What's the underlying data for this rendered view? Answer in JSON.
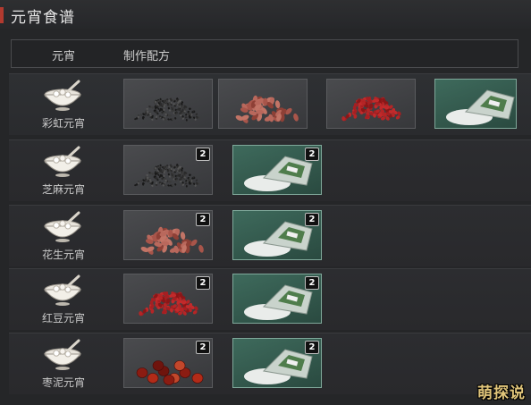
{
  "window": {
    "title": "元宵食谱"
  },
  "header": {
    "col_name": "元宵",
    "col_recipe": "制作配方"
  },
  "rows": [
    {
      "name": "彩虹元宵",
      "ingredients": [
        {
          "item": "black-sesame",
          "count": ""
        },
        {
          "item": "peanuts",
          "count": ""
        },
        {
          "item": "red-beans",
          "count": ""
        },
        {
          "item": "glutinous-rice-flour",
          "count": ""
        }
      ]
    },
    {
      "name": "芝麻元宵",
      "ingredients": [
        {
          "item": "black-sesame",
          "count": "2"
        },
        {
          "item": "glutinous-rice-flour",
          "count": "2"
        }
      ]
    },
    {
      "name": "花生元宵",
      "ingredients": [
        {
          "item": "peanuts",
          "count": "2"
        },
        {
          "item": "glutinous-rice-flour",
          "count": "2"
        }
      ]
    },
    {
      "name": "红豆元宵",
      "ingredients": [
        {
          "item": "red-beans",
          "count": "2"
        },
        {
          "item": "glutinous-rice-flour",
          "count": "2"
        }
      ]
    },
    {
      "name": "枣泥元宵",
      "ingredients": [
        {
          "item": "red-dates",
          "count": "2"
        },
        {
          "item": "glutinous-rice-flour",
          "count": "2"
        }
      ]
    }
  ],
  "watermark": "萌探说",
  "colors": {
    "accent": "#b23a2f",
    "slot_green": "#3e6a5c",
    "slot_gray": "#45464a"
  }
}
